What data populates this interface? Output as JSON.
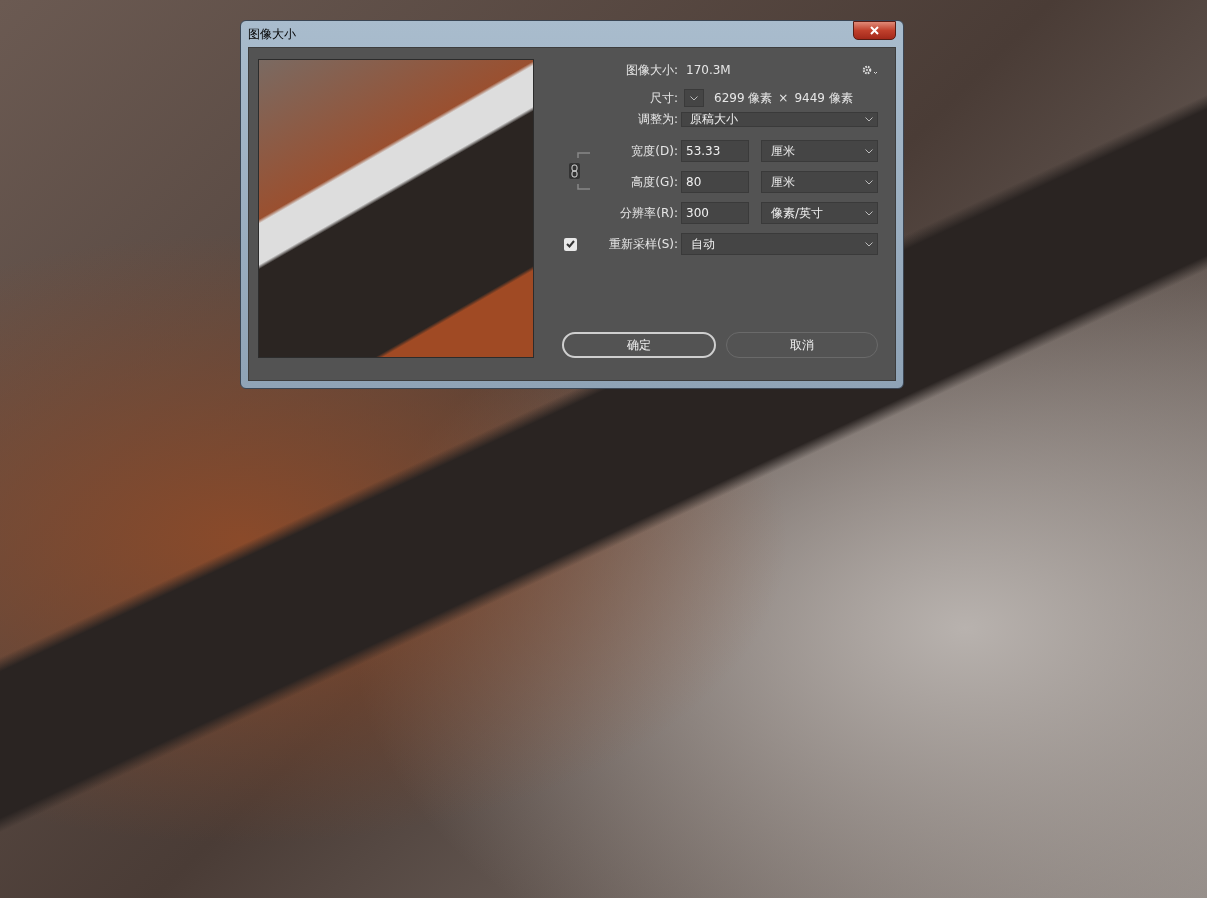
{
  "window": {
    "title": "图像大小"
  },
  "image_size": {
    "label": "图像大小:",
    "value": "170.3M"
  },
  "dimensions": {
    "label": "尺寸:",
    "width": "6299 像素",
    "times": "×",
    "height": "9449 像素"
  },
  "fit_to": {
    "label": "调整为:",
    "value": "原稿大小"
  },
  "fields": [
    {
      "label": "宽度(D):",
      "value": "53.33",
      "unit": "厘米"
    },
    {
      "label": "高度(G):",
      "value": "80",
      "unit": "厘米"
    },
    {
      "label": "分辨率(R):",
      "value": "300",
      "unit": "像素/英寸"
    }
  ],
  "resample": {
    "label": "重新采样(S):",
    "checked": true,
    "value": "自动"
  },
  "buttons": [
    {
      "label": "确定",
      "selected": true
    },
    {
      "label": "取消",
      "selected": false
    }
  ]
}
